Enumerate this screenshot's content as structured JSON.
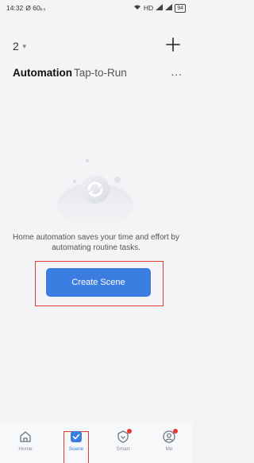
{
  "status_bar": {
    "time": "14:32",
    "indicators": "Ø 60ₖₛ",
    "network": "HD",
    "battery": "94"
  },
  "header": {
    "home_name": "2",
    "add_icon": "plus-icon"
  },
  "tabs": [
    {
      "label": "Automation",
      "active": true
    },
    {
      "label": "Tap-to-Run",
      "active": false
    }
  ],
  "more": "...",
  "empty_state": {
    "message": "Home automation saves your time and effort by automating routine tasks.",
    "button_label": "Create Scene"
  },
  "bottom_nav": [
    {
      "label": "Home",
      "icon": "home-icon"
    },
    {
      "label": "Scene",
      "icon": "scene-check-icon",
      "active": true
    },
    {
      "label": "Smart",
      "icon": "smart-shield-icon",
      "badge": true
    },
    {
      "label": "Me",
      "icon": "user-icon",
      "badge": true
    }
  ],
  "colors": {
    "accent": "#3b7de0",
    "highlight": "#e53935",
    "background": "#f3f4f6"
  }
}
